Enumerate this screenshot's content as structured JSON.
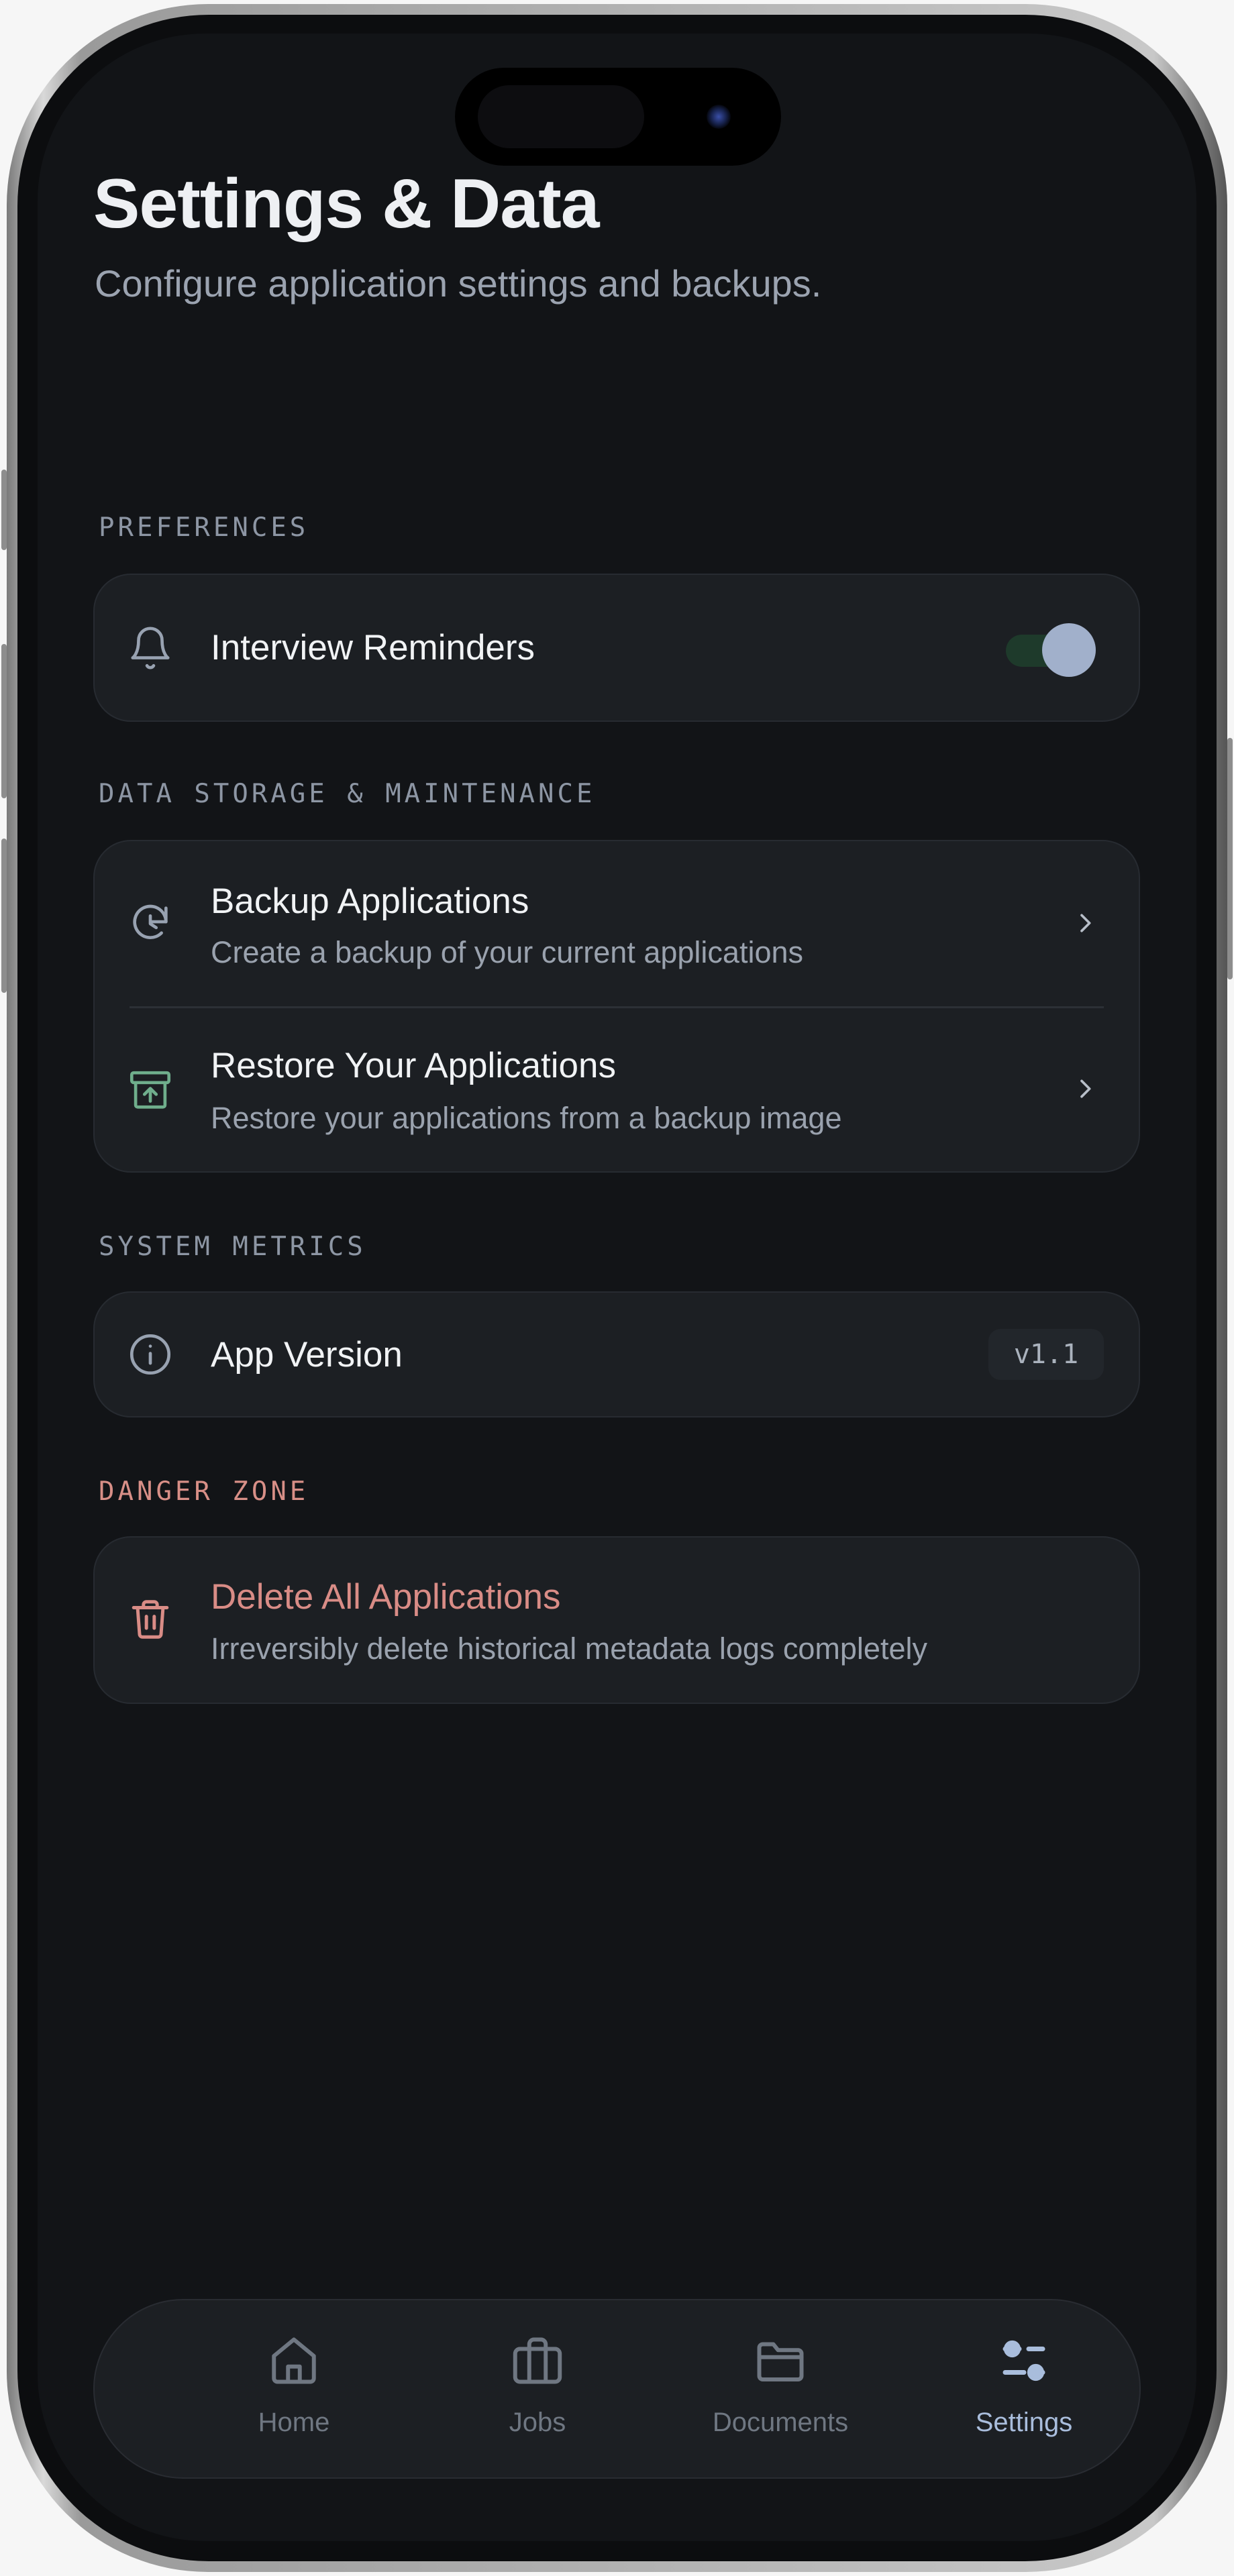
{
  "header": {
    "title": "Settings & Data",
    "subtitle": "Configure application settings and backups."
  },
  "sections": {
    "preferences": {
      "label": "PREFERENCES",
      "reminders": {
        "icon": "bell-icon",
        "label": "Interview Reminders",
        "enabled": true
      }
    },
    "data_storage": {
      "label": "DATA STORAGE & MAINTENANCE",
      "backup": {
        "icon": "backup-refresh-icon",
        "title": "Backup Applications",
        "description": "Create a backup of your current applications"
      },
      "restore": {
        "icon": "archive-upload-icon",
        "title": "Restore Your Applications",
        "description": "Restore your applications from a backup image"
      }
    },
    "system_metrics": {
      "label": "SYSTEM METRICS",
      "app_version": {
        "icon": "info-icon",
        "label": "App Version",
        "value": "v1.1"
      }
    },
    "danger_zone": {
      "label": "DANGER ZONE",
      "delete_all": {
        "icon": "trash-icon",
        "title": "Delete All Applications",
        "description": "Irreversibly delete historical metadata logs completely"
      }
    }
  },
  "nav": {
    "items": [
      {
        "label": "Home",
        "icon": "home-icon",
        "active": false
      },
      {
        "label": "Jobs",
        "icon": "briefcase-icon",
        "active": false
      },
      {
        "label": "Documents",
        "icon": "folder-icon",
        "active": false
      },
      {
        "label": "Settings",
        "icon": "sliders-icon",
        "active": true
      }
    ]
  },
  "colors": {
    "background": "#121417",
    "card": "#1c1f23",
    "accent": "#a9bddc",
    "danger": "#d98c86",
    "restore_icon": "#6fae8c",
    "toggle_track": "#1e3a2b",
    "toggle_knob": "#a1b0cb"
  }
}
